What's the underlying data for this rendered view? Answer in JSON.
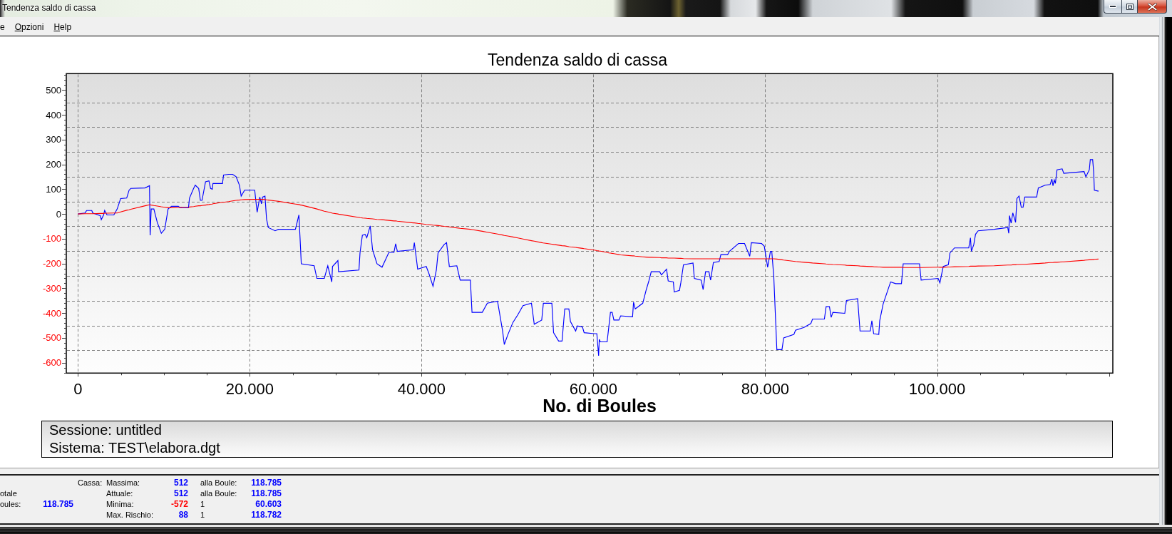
{
  "window": {
    "title": "Tendenza saldo di cassa"
  },
  "menu": [
    {
      "label": "e",
      "accelerator": false
    },
    {
      "label": "Opzioni",
      "accelerator": true
    },
    {
      "label": "Help",
      "accelerator": true
    }
  ],
  "chart": {
    "chart_data": {
      "type": "line",
      "title": "Tendenza saldo di cassa",
      "xlabel": "No. di Boules",
      "grid": true,
      "x": [
        0,
        820,
        1020,
        1610,
        1730,
        2600,
        2720,
        2990,
        3110,
        3390,
        4180,
        4570,
        4970,
        5680,
        5960,
        6160,
        7820,
        8330,
        8410,
        8530,
        8840,
        9240,
        9710,
        10110,
        10500,
        10900,
        11690,
        11890,
        12870,
        12990,
        13470,
        13660,
        14060,
        14260,
        14450,
        14850,
        15250,
        15440,
        15640,
        15720,
        16830,
        16950,
        17540,
        18010,
        18410,
        18800,
        19000,
        19400,
        20580,
        20700,
        20860,
        21170,
        21370,
        21490,
        21770,
        21960,
        22160,
        22950,
        23350,
        25320,
        25720,
        25920,
        26000,
        27500,
        27810,
        28680,
        29080,
        29550,
        29630,
        30260,
        30340,
        32710,
        32830,
        33110,
        33420,
        33620,
        34020,
        34290,
        34810,
        35400,
        36190,
        36780,
        36980,
        37180,
        39040,
        39160,
        39550,
        40540,
        40850,
        41330,
        41720,
        41920,
        42630,
        42910,
        43230,
        44100,
        44490,
        45680,
        45870,
        47060,
        47650,
        48840,
        49430,
        49630,
        50020,
        50620,
        51210,
        51800,
        52790,
        53110,
        53980,
        54170,
        55160,
        55360,
        55950,
        56350,
        56660,
        57140,
        57330,
        57930,
        58120,
        58720,
        58920,
        60100,
        60400,
        60603,
        60680,
        60800,
        61590,
        61790,
        61980,
        62180,
        62380,
        62970,
        63170,
        64550,
        64670,
        64870,
        65740,
        66130,
        66450,
        66730,
        67710,
        67910,
        68510,
        68700,
        69300,
        69410,
        70010,
        70170,
        70480,
        71590,
        71750,
        72540,
        72770,
        73050,
        73440,
        73640,
        73960,
        74630,
        74830,
        75620,
        75820,
        76880,
        77590,
        78190,
        78380,
        79570,
        79890,
        80280,
        80600,
        80760,
        80990,
        81350,
        81940,
        82140,
        83330,
        83520,
        84510,
        85300,
        85500,
        86880,
        87080,
        87470,
        87670,
        87870,
        89250,
        89450,
        90750,
        91030,
        92220,
        92410,
        92610,
        93210,
        93320,
        93720,
        93990,
        94590,
        95180,
        95850,
        96050,
        97950,
        98140,
        100120,
        100320,
        100710,
        101310,
        101500,
        102020,
        103680,
        103880,
        103990,
        104270,
        104470,
        104780,
        106640,
        108220,
        108340,
        108420,
        108620,
        108810,
        109130,
        109290,
        109530,
        109800,
        110000,
        110200,
        111580,
        111780,
        112570,
        113160,
        113360,
        113480,
        113640,
        113760,
        113950,
        114550,
        114740,
        117110,
        117310,
        117710,
        117830,
        118100,
        118220,
        118300,
        118785
      ],
      "series": [
        {
          "color": "#0000ff",
          "values": [
            0,
            4,
            14,
            14,
            4,
            -7,
            -23,
            -4,
            14,
            -4,
            -4,
            20,
            62,
            64,
            96,
            103,
            105,
            114,
            -86,
            20,
            20,
            -34,
            -78,
            -62,
            20,
            31,
            31,
            25,
            25,
            64,
            103,
            116,
            103,
            55,
            55,
            130,
            133,
            103,
            100,
            123,
            123,
            157,
            160,
            160,
            150,
            116,
            72,
            96,
            96,
            55,
            7,
            68,
            41,
            68,
            72,
            -21,
            -55,
            -68,
            -62,
            -62,
            -4,
            -144,
            -201,
            -209,
            -260,
            -260,
            -209,
            -274,
            -212,
            -188,
            -233,
            -226,
            -157,
            -86,
            -82,
            -96,
            -48,
            -144,
            -201,
            -215,
            -155,
            -155,
            -120,
            -151,
            -144,
            -116,
            -223,
            -212,
            -240,
            -292,
            -226,
            -157,
            -123,
            -116,
            -212,
            -209,
            -267,
            -267,
            -397,
            -397,
            -360,
            -352,
            -472,
            -527,
            -489,
            -438,
            -406,
            -370,
            -360,
            -445,
            -428,
            -360,
            -360,
            -479,
            -513,
            -513,
            -383,
            -383,
            -434,
            -472,
            -452,
            -456,
            -479,
            -483,
            -483,
            -572,
            -506,
            -516,
            -516,
            -456,
            -397,
            -397,
            -428,
            -428,
            -411,
            -415,
            -356,
            -383,
            -360,
            -308,
            -270,
            -233,
            -233,
            -246,
            -223,
            -270,
            -274,
            -315,
            -308,
            -278,
            -205,
            -198,
            -260,
            -267,
            -305,
            -233,
            -233,
            -267,
            -196,
            -192,
            -164,
            -164,
            -151,
            -119,
            -119,
            -171,
            -116,
            -119,
            -130,
            -215,
            -151,
            -151,
            -253,
            -547,
            -547,
            -500,
            -486,
            -469,
            -458,
            -442,
            -424,
            -424,
            -374,
            -374,
            -417,
            -397,
            -401,
            -349,
            -342,
            -472,
            -472,
            -431,
            -483,
            -486,
            -431,
            -363,
            -335,
            -274,
            -281,
            -281,
            -201,
            -201,
            -267,
            -260,
            -278,
            -212,
            -205,
            -157,
            -137,
            -137,
            -96,
            -151,
            -123,
            -82,
            -68,
            -62,
            -55,
            -78,
            -7,
            -37,
            4,
            -34,
            62,
            72,
            27,
            27,
            68,
            68,
            105,
            116,
            119,
            141,
            114,
            137,
            123,
            178,
            182,
            164,
            171,
            150,
            178,
            219,
            219,
            171,
            96,
            92
          ]
        },
        {
          "color": "#ff0000",
          "values": [
            0,
            1,
            1,
            1,
            1,
            2,
            2,
            2,
            3,
            3,
            4,
            4,
            8,
            15,
            17,
            19,
            33,
            37,
            37,
            36,
            34,
            32,
            29,
            27,
            25,
            25,
            26,
            26,
            27,
            28,
            30,
            31,
            33,
            33,
            34,
            36,
            38,
            39,
            40,
            41,
            47,
            47,
            50,
            53,
            55,
            56,
            57,
            58,
            59,
            59,
            59,
            59,
            59,
            59,
            58,
            57,
            56,
            53,
            51,
            40,
            38,
            36,
            36,
            23,
            20,
            11,
            8,
            4,
            3,
            0,
            -1,
            -14,
            -15,
            -16,
            -17,
            -18,
            -19,
            -20,
            -22,
            -23,
            -26,
            -28,
            -28,
            -29,
            -36,
            -36,
            -38,
            -42,
            -43,
            -45,
            -46,
            -47,
            -50,
            -51,
            -52,
            -56,
            -58,
            -62,
            -63,
            -70,
            -74,
            -81,
            -85,
            -87,
            -89,
            -93,
            -97,
            -101,
            -108,
            -110,
            -116,
            -117,
            -122,
            -123,
            -126,
            -128,
            -129,
            -132,
            -133,
            -135,
            -136,
            -139,
            -140,
            -146,
            -148,
            -149,
            -150,
            -150,
            -155,
            -157,
            -158,
            -159,
            -160,
            -164,
            -165,
            -169,
            -169,
            -170,
            -173,
            -174,
            -175,
            -175,
            -176,
            -177,
            -177,
            -178,
            -178,
            -178,
            -179,
            -179,
            -180,
            -181,
            -181,
            -181,
            -181,
            -181,
            -181,
            -181,
            -181,
            -181,
            -181,
            -181,
            -181,
            -181,
            -181,
            -181,
            -181,
            -181,
            -181,
            -181,
            -181,
            -181,
            -181,
            -182,
            -185,
            -186,
            -191,
            -192,
            -195,
            -197,
            -198,
            -201,
            -202,
            -203,
            -203,
            -204,
            -206,
            -207,
            -209,
            -210,
            -212,
            -212,
            -213,
            -214,
            -214,
            -215,
            -215,
            -215,
            -215,
            -215,
            -216,
            -216,
            -216,
            -215,
            -215,
            -215,
            -214,
            -214,
            -213,
            -212,
            -211,
            -211,
            -211,
            -211,
            -210,
            -209,
            -206,
            -206,
            -206,
            -206,
            -205,
            -205,
            -204,
            -204,
            -203,
            -203,
            -203,
            -200,
            -200,
            -198,
            -196,
            -196,
            -196,
            -195,
            -195,
            -195,
            -193,
            -193,
            -187,
            -186,
            -185,
            -185,
            -184,
            -184,
            -183,
            -182
          ]
        }
      ],
      "xlim": [
        -1350,
        120450
      ],
      "ylim": [
        -642,
        566
      ],
      "xticks": [
        0,
        {
          "value": 20000,
          "label": "20.000"
        },
        {
          "value": 40000,
          "label": "40.000"
        },
        {
          "value": 60000,
          "label": "60.000"
        },
        {
          "value": 80000,
          "label": "80.000"
        },
        {
          "value": 100000,
          "label": "100.000"
        }
      ],
      "yticks": [
        -600,
        -500,
        -400,
        -300,
        -200,
        -100,
        0,
        100,
        200,
        300,
        400,
        500
      ]
    }
  },
  "session_box": {
    "lines": [
      "Sessione: untitled",
      "Sistema: TEST\\elabora.dgt"
    ]
  },
  "summary": {
    "rows": [
      {
        "group": "Cassa:",
        "label": "Massima:",
        "value": "512",
        "color": "#0000ff",
        "at_label": "alla Boule:",
        "at_value": "118.785"
      },
      {
        "caption": "otale",
        "label": "Attuale:",
        "value": "512",
        "color": "#0000ff",
        "at_label": "alla Boule:",
        "at_value": "118.785"
      },
      {
        "caption": "oules:",
        "caption_value": "118.785",
        "label": "Minima:",
        "value": "-572",
        "color": "#ff0000",
        "at_label": "1",
        "at_value": "60.603"
      },
      {
        "label": "Max. Rischio:",
        "value": "88",
        "color": "#0000ff",
        "at_label": "1",
        "at_value": "118.782"
      }
    ]
  }
}
